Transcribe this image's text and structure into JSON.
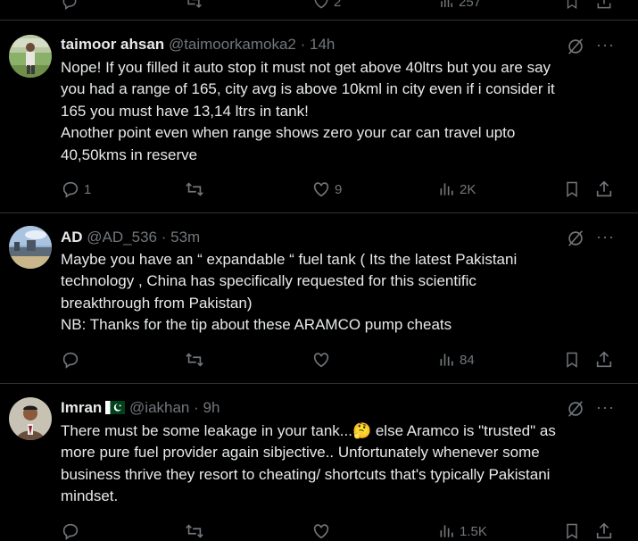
{
  "tweets": [
    {
      "name": "taimoor ahsan",
      "handle": "@taimoorkamoka2",
      "sep": " · ",
      "time": "14h",
      "text": "Nope! If you filled it auto stop it must not get above 40ltrs but you are say\nyou had a range of 165, city avg is above 10kml in city even if i consider it\n165 you must have 13,14 ltrs in tank!\nAnother point even when range shows zero your car can travel upto\n40,50kms in reserve",
      "replies": "1",
      "reposts": "",
      "likes": "9",
      "views": "2K"
    },
    {
      "name": "AD",
      "handle": "@AD_536",
      "sep": " · ",
      "time": "53m",
      "text": "Maybe you have an “ expandable “ fuel tank ( Its the latest Pakistani\ntechnology , China has specifically requested for this scientific\nbreakthrough from Pakistan)\nNB: Thanks for the tip about these ARAMCO pump cheats",
      "replies": "",
      "reposts": "",
      "likes": "",
      "views": "84"
    },
    {
      "name": "Imran",
      "handle": "@iakhan",
      "sep": " · ",
      "time": "9h",
      "text": "There must be some leakage in your tank...🤔 else Aramco is \"trusted\" as\nmore pure fuel provider again sibjective.. Unfortunately whenever some\nbusiness thrive they resort to cheating/ shortcuts that's typically Pakistani\nmindset.",
      "replies": "",
      "reposts": "",
      "likes": "",
      "views": "1.5K"
    }
  ],
  "topbar": {
    "likes": "2",
    "views": "257"
  },
  "more_glyph": "···",
  "colors": {
    "background": "#000000",
    "text": "#e7e9ea",
    "muted": "#71767b",
    "divider": "#2f3336"
  },
  "icons": [
    "reply-icon",
    "repost-icon",
    "like-icon",
    "views-icon",
    "bookmark-icon",
    "share-icon",
    "grok-icon",
    "more-icon",
    "pakistan-flag-icon"
  ]
}
